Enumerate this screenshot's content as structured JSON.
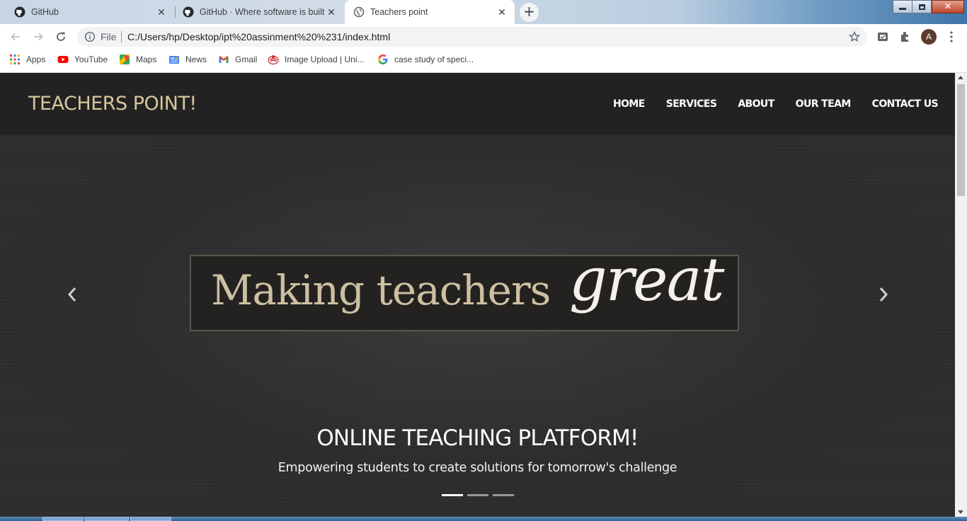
{
  "browser": {
    "tabs": [
      {
        "title": "GitHub",
        "icon": "github-icon",
        "active": false
      },
      {
        "title": "GitHub · Where software is built",
        "icon": "github-icon",
        "active": false
      },
      {
        "title": "Teachers point",
        "icon": "globe-icon",
        "active": true
      }
    ],
    "address": {
      "scheme_label": "File",
      "url": "C:/Users/hp/Desktop/ipt%20assinment%20%231/index.html"
    },
    "profile_initial": "A",
    "bookmarks": [
      {
        "label": "Apps",
        "icon": "apps-grid-icon"
      },
      {
        "label": "YouTube",
        "icon": "youtube-icon"
      },
      {
        "label": "Maps",
        "icon": "maps-icon"
      },
      {
        "label": "News",
        "icon": "news-icon"
      },
      {
        "label": "Gmail",
        "icon": "gmail-icon"
      },
      {
        "label": "Image Upload | Uni...",
        "icon": "image-upload-icon"
      },
      {
        "label": "case study of speci...",
        "icon": "google-icon"
      }
    ]
  },
  "site": {
    "brand": "TEACHERS POINT!",
    "nav": [
      "HOME",
      "SERVICES",
      "ABOUT",
      "OUR TEAM",
      "CONTACT US"
    ],
    "slide": {
      "image_text_main": "Making teachers",
      "image_text_script": "great",
      "caption_title": "ONLINE TEACHING PLATFORM!",
      "caption_sub": "Empowering students to create solutions for tomorrow's challenge",
      "slide_count": 3,
      "active_slide": 1
    }
  },
  "colors": {
    "brand": "#d8c69c",
    "nav_bg": "#222222",
    "hero_bg": "#2e2e2e"
  }
}
